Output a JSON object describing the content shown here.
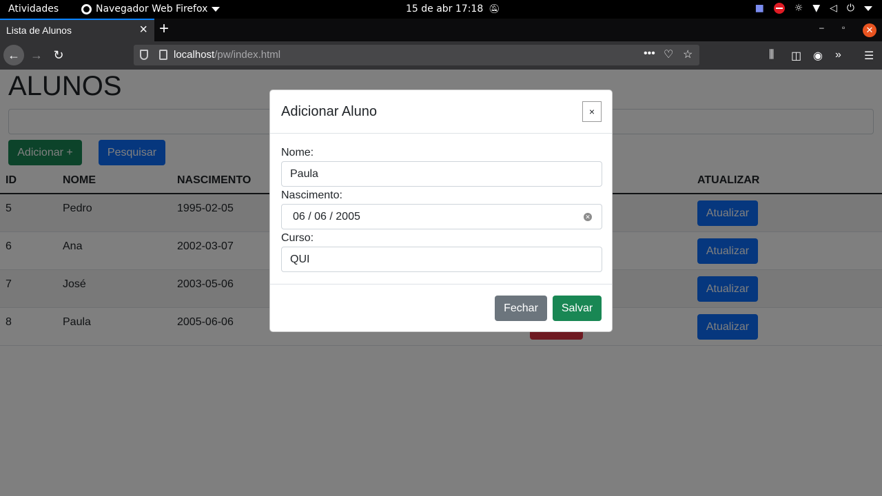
{
  "topbar": {
    "activities": "Atividades",
    "app_name": "Navegador Web Firefox",
    "clock": "15 de abr  17:18"
  },
  "browser": {
    "tab_title": "Lista de Alunos",
    "url_host": "localhost",
    "url_path": "/pw/index.html"
  },
  "page": {
    "heading": "ALUNOS",
    "add_button": "Adicionar +",
    "search_button": "Pesquisar",
    "columns": [
      "ID",
      "NOME",
      "NASCIMENTO",
      "ATUALIZAR"
    ],
    "rows": [
      {
        "id": "5",
        "nome": "Pedro",
        "nascimento": "1995-02-05",
        "atualizar": "Atualizar"
      },
      {
        "id": "6",
        "nome": "Ana",
        "nascimento": "2002-03-07",
        "atualizar": "Atualizar"
      },
      {
        "id": "7",
        "nome": "José",
        "nascimento": "2003-05-06",
        "atualizar": "Atualizar"
      },
      {
        "id": "8",
        "nome": "Paula",
        "nascimento": "2005-06-06",
        "atualizar": "Atualizar"
      }
    ]
  },
  "modal": {
    "title": "Adicionar Aluno",
    "close_label": "×",
    "nome_label": "Nome:",
    "nome_value": "Paula",
    "nascimento_label": "Nascimento:",
    "nascimento_value": "06 / 06 / 2005",
    "curso_label": "Curso:",
    "curso_value": "QUI",
    "close_button": "Fechar",
    "save_button": "Salvar"
  },
  "colors": {
    "primary": "#0d6efd",
    "success": "#198754",
    "danger": "#dc3545",
    "secondary": "#6c757d",
    "ubuntu_orange": "#e95420"
  }
}
